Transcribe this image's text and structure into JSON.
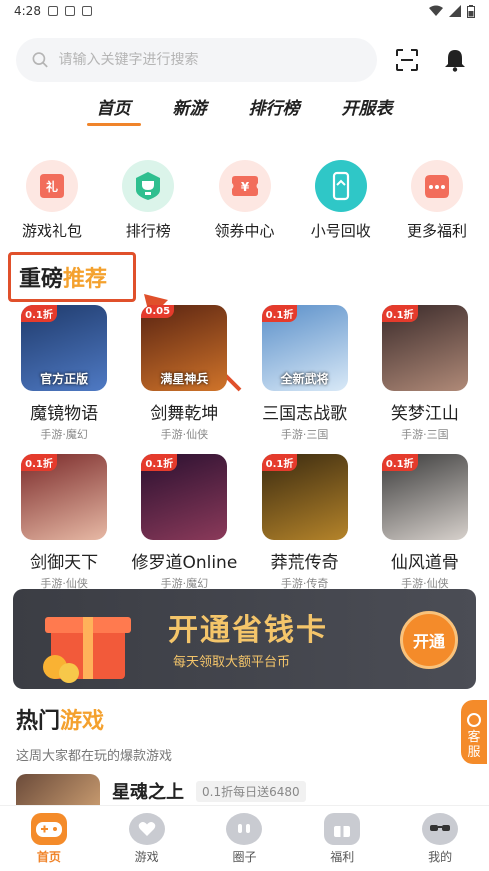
{
  "status": {
    "time": "4:28"
  },
  "search": {
    "placeholder": "请输入关键字进行搜索"
  },
  "tabs": [
    {
      "label": "首页",
      "active": true
    },
    {
      "label": "新游",
      "active": false
    },
    {
      "label": "排行榜",
      "active": false
    },
    {
      "label": "开服表",
      "active": false
    }
  ],
  "quick": [
    {
      "label": "游戏礼包",
      "icon": "gift-icon",
      "color": "#f26d5b",
      "glyph": "礼"
    },
    {
      "label": "排行榜",
      "icon": "trophy-icon",
      "color": "#2fbf8f",
      "glyph": "♛"
    },
    {
      "label": "领券中心",
      "icon": "coupon-icon",
      "color": "#f26d5b",
      "glyph": "¥"
    },
    {
      "label": "小号回收",
      "icon": "phone-icon",
      "color": "#2fc7c7",
      "glyph": "▯"
    },
    {
      "label": "更多福利",
      "icon": "more-icon",
      "color": "#f26d5b",
      "glyph": "•••"
    }
  ],
  "featured": {
    "title_a": "重磅",
    "title_b": "推荐"
  },
  "games": [
    {
      "name": "魔镜物语",
      "tag": "手游·魔幻",
      "badge": "0.1折",
      "cover_text": "官方正版",
      "colors": [
        "#1f3a6b",
        "#4f7ac4"
      ]
    },
    {
      "name": "剑舞乾坤",
      "tag": "手游·仙侠",
      "badge": "0.05",
      "cover_text": "满星神兵",
      "colors": [
        "#5a2412",
        "#d0742a"
      ]
    },
    {
      "name": "三国志战歌",
      "tag": "手游·三国",
      "badge": "0.1折",
      "cover_text": "全新武将",
      "colors": [
        "#5a8fc9",
        "#d9e9f7"
      ]
    },
    {
      "name": "笑梦江山",
      "tag": "手游·三国",
      "badge": "0.1折",
      "cover_text": "",
      "colors": [
        "#3a2a2a",
        "#b08a78"
      ]
    },
    {
      "name": "剑御天下",
      "tag": "手游·仙侠",
      "badge": "0.1折",
      "cover_text": "",
      "colors": [
        "#7a2a2a",
        "#e7b9a5"
      ]
    },
    {
      "name": "修罗道Online",
      "tag": "手游·魔幻",
      "badge": "0.1折",
      "cover_text": "",
      "colors": [
        "#2a1030",
        "#8b3a5a"
      ]
    },
    {
      "name": "莽荒传奇",
      "tag": "手游·传奇",
      "badge": "0.1折",
      "cover_text": "",
      "colors": [
        "#3a2a10",
        "#b5842a"
      ]
    },
    {
      "name": "仙风道骨",
      "tag": "手游·仙侠",
      "badge": "0.1折",
      "cover_text": "",
      "colors": [
        "#3b3b3b",
        "#d7d1cc"
      ]
    }
  ],
  "banner": {
    "title": "开通省钱卡",
    "subtitle": "每天领取大额平台币",
    "button": "开通"
  },
  "hot": {
    "title_a": "热门",
    "title_b": "游戏",
    "subtitle": "这周大家都在玩的爆款游戏",
    "first_name": "星魂之上",
    "first_promo": "0.1折每日送6480"
  },
  "service": {
    "label_1": "客",
    "label_2": "服"
  },
  "bottom_nav": [
    {
      "label": "首页",
      "icon": "gamepad-icon",
      "active": true
    },
    {
      "label": "游戏",
      "icon": "heart-chat-icon",
      "active": false
    },
    {
      "label": "圈子",
      "icon": "circle-chat-icon",
      "active": false
    },
    {
      "label": "福利",
      "icon": "gift-box-icon",
      "active": false
    },
    {
      "label": "我的",
      "icon": "sunglasses-face-icon",
      "active": false
    }
  ]
}
